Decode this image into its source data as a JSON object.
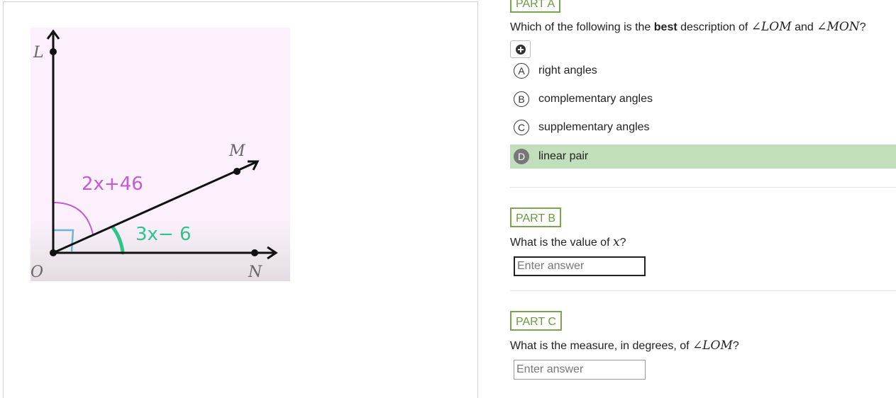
{
  "diagram": {
    "label_L": "L",
    "label_M": "M",
    "label_N": "N",
    "label_O": "O",
    "expr_lom": "2x+46",
    "expr_mon": "3x− 6",
    "color_lom": "#c45bd0",
    "color_mon": "#2fc58a"
  },
  "part_a": {
    "label": "PART A",
    "question_prefix": "Which of the following is the ",
    "question_bold": "best",
    "question_mid": " description of ",
    "angle1": "∠LOM",
    "question_and": " and ",
    "angle2": "∠MON",
    "question_end": "?",
    "tool_icon": "plus-circle-icon",
    "choices": [
      {
        "letter": "A",
        "text": "right angles"
      },
      {
        "letter": "B",
        "text": "complementary angles"
      },
      {
        "letter": "C",
        "text": "supplementary angles"
      },
      {
        "letter": "D",
        "text": "linear pair"
      }
    ],
    "selected": "D"
  },
  "part_b": {
    "label": "PART B",
    "question_prefix": "What is the value of ",
    "variable": "x",
    "question_end": "?",
    "placeholder": "Enter answer"
  },
  "part_c": {
    "label": "PART C",
    "question_prefix": "What is the measure, in degrees, of ",
    "angle": "∠LOM",
    "question_end": "?",
    "placeholder": "Enter answer"
  },
  "colors": {
    "accent_green": "#7aa64f",
    "selected_bg": "#c1dfbb"
  }
}
